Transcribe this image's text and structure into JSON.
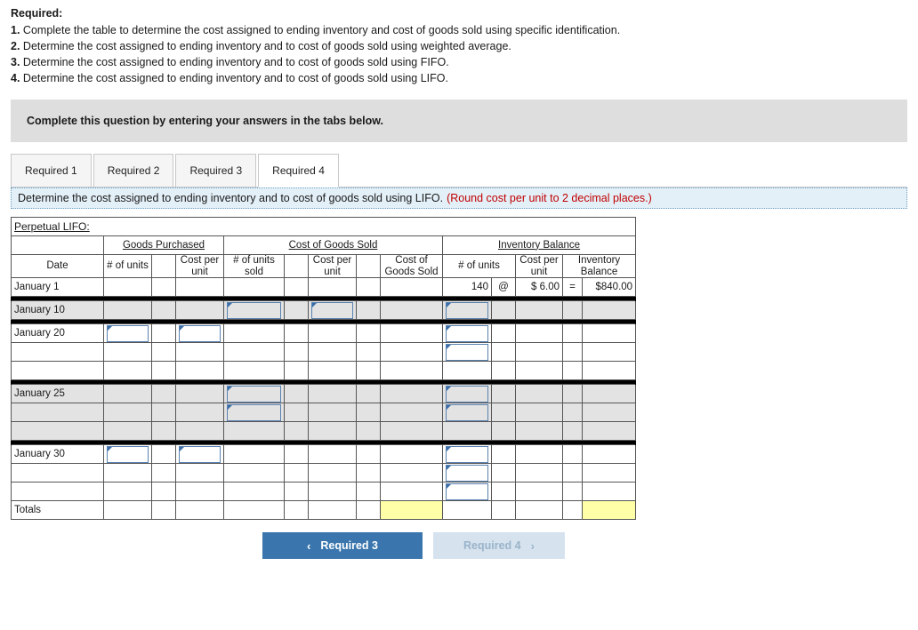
{
  "required": {
    "heading": "Required:",
    "items": [
      {
        "num": "1.",
        "text": "Complete the table to determine the cost assigned to ending inventory and cost of goods sold using specific identification."
      },
      {
        "num": "2.",
        "text": "Determine the cost assigned to ending inventory and to cost of goods sold using weighted average."
      },
      {
        "num": "3.",
        "text": "Determine the cost assigned to ending inventory and to cost of goods sold using FIFO."
      },
      {
        "num": "4.",
        "text": "Determine the cost assigned to ending inventory and to cost of goods sold using LIFO."
      }
    ]
  },
  "banner": {
    "text": "Complete this question by entering your answers in the tabs below."
  },
  "tabs": [
    {
      "label": "Required 1",
      "active": false
    },
    {
      "label": "Required 2",
      "active": false
    },
    {
      "label": "Required 3",
      "active": false
    },
    {
      "label": "Required 4",
      "active": true
    }
  ],
  "instruction": {
    "main": "Determine the cost assigned to ending inventory and to cost of goods sold using LIFO.",
    "note": "(Round cost per unit to 2 decimal places.)"
  },
  "worksheet": {
    "title": "Perpetual LIFO:",
    "group_headers": {
      "date": "",
      "goods_purchased": "Goods Purchased",
      "cost_of_goods_sold": "Cost of Goods Sold",
      "inventory_balance": "Inventory Balance"
    },
    "sub_headers": {
      "date": "Date",
      "gp_units": "# of units",
      "gp_at": "",
      "gp_cost_per_unit": "Cost per unit",
      "cogs_units_sold": "# of units sold",
      "cogs_at": "",
      "cogs_cost_per_unit": "Cost per unit",
      "cogs_eq": "",
      "cogs_total": "Cost of Goods Sold",
      "ib_units": "# of units",
      "ib_at": "",
      "ib_cost_per_unit": "Cost per unit",
      "ib_eq": "",
      "ib_balance": "Inventory Balance"
    },
    "rows": {
      "january_1": {
        "date": "January 1",
        "ib_units": "140",
        "ib_at": "@",
        "ib_cost_per_unit": "$  6.00",
        "ib_eq": "=",
        "ib_balance": "$840.00"
      },
      "january_10": {
        "date": "January 10"
      },
      "january_20": {
        "date": "January 20"
      },
      "january_25": {
        "date": "January 25"
      },
      "january_30": {
        "date": "January 30"
      },
      "totals": {
        "date": "Totals"
      }
    }
  },
  "nav": {
    "prev_label": "Required 3",
    "prev_chevron": "‹",
    "next_label": "Required 4",
    "next_chevron": "›"
  }
}
